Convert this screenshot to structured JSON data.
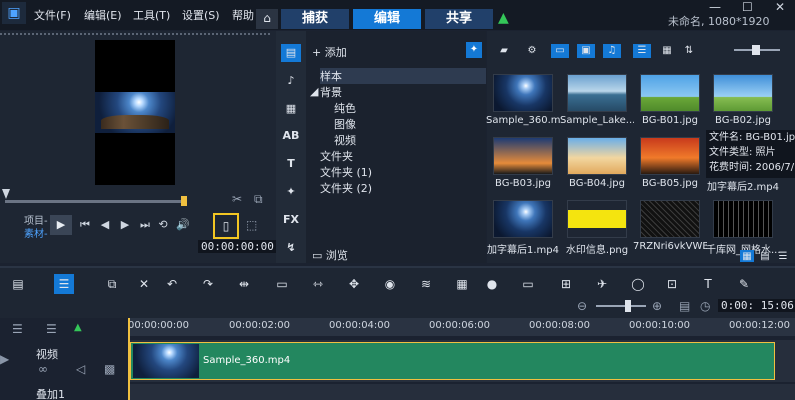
{
  "menu": {
    "items": [
      "文件(F)",
      "编辑(E)",
      "工具(T)",
      "设置(S)",
      "帮助"
    ]
  },
  "steps": {
    "capture": "捕获",
    "edit": "编辑",
    "share": "共享"
  },
  "project": {
    "info": "未命名, 1080*1920"
  },
  "player": {
    "mode_project": "项目-",
    "mode_clip": "素材-",
    "timecode": "00:00:00:00"
  },
  "library": {
    "add_label": "添加",
    "tree": {
      "sample": "样本",
      "background": "背景",
      "solid": "纯色",
      "image": "图像",
      "video": "视频",
      "folder": "文件夹",
      "folder1": "文件夹 (1)",
      "folder2": "文件夹 (2)"
    },
    "browse": "浏览",
    "nav_icons": [
      "media-icon",
      "audio-note-icon",
      "title-icon",
      "AB",
      "T",
      "graphics-icon",
      "FX",
      "path-icon"
    ]
  },
  "media": {
    "items": [
      {
        "label": "Sample_360.mp4"
      },
      {
        "label": "Sample_Lake..."
      },
      {
        "label": "BG-B01.jpg"
      },
      {
        "label": "BG-B02.jpg"
      },
      {
        "label": "BG-B03.jpg"
      },
      {
        "label": "BG-B04.jpg"
      },
      {
        "label": "BG-B05.jpg"
      },
      {
        "label": "加字幕后2.mp4"
      },
      {
        "label": "加字幕后1.mp4"
      },
      {
        "label": "水印信息.png"
      },
      {
        "label": "7RZNri6vkVWB..."
      },
      {
        "label": "千库网_网格水..."
      }
    ],
    "tooltip": {
      "name": "文件名: BG-B01.jpg",
      "type": "文件类型: 照片",
      "time": "花费时间: 2006/7/..."
    }
  },
  "timeline": {
    "timecode": "0:00: 15:06",
    "ruler": [
      "00:00:00:00",
      "00:00:02:00",
      "00:00:04:00",
      "00:00:06:00",
      "00:00:08:00",
      "00:00:10:00",
      "00:00:12:00"
    ],
    "tracks": {
      "video": "视频",
      "overlay": "叠加1"
    },
    "clip_name": "Sample_360.mp4"
  }
}
